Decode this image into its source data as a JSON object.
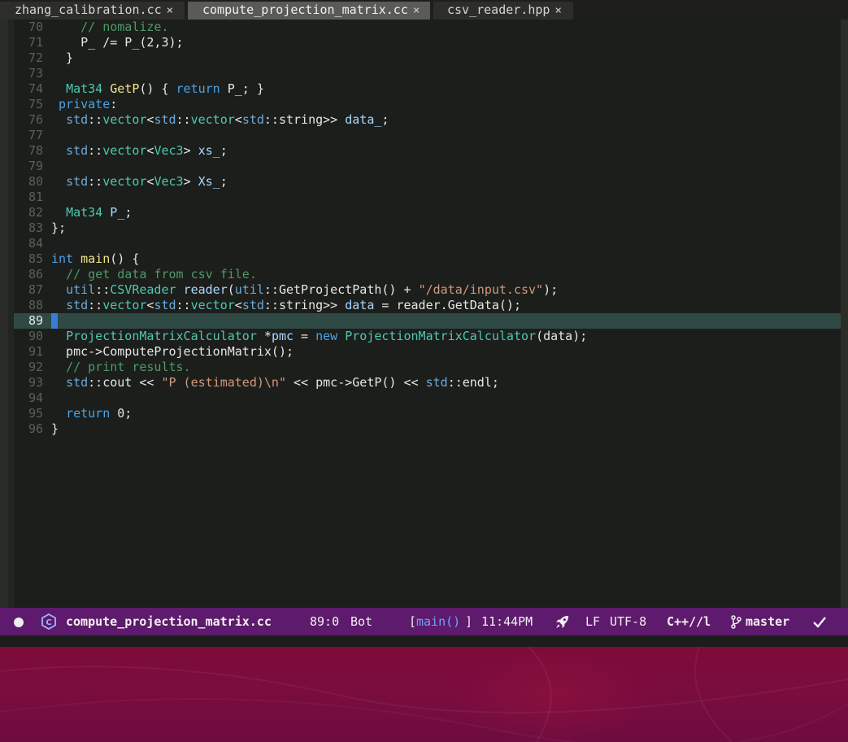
{
  "tabs": [
    {
      "label": "zhang_calibration.cc",
      "close": "×",
      "active": false
    },
    {
      "label": "compute_projection_matrix.cc",
      "close": "×",
      "active": true
    },
    {
      "label": "csv_reader.hpp",
      "close": "×",
      "active": false
    }
  ],
  "editor": {
    "current_line": "89",
    "lines": [
      {
        "n": "70",
        "tokens": [
          [
            "    ",
            "plain"
          ],
          [
            "// nomalize.",
            "com"
          ]
        ]
      },
      {
        "n": "71",
        "tokens": [
          [
            "    P_ /= P_(2,3);",
            "plain"
          ]
        ]
      },
      {
        "n": "72",
        "tokens": [
          [
            "  }",
            "plain"
          ]
        ]
      },
      {
        "n": "73",
        "tokens": []
      },
      {
        "n": "74",
        "tokens": [
          [
            "  ",
            "plain"
          ],
          [
            "Mat34",
            "type"
          ],
          [
            " ",
            "plain"
          ],
          [
            "GetP",
            "fn"
          ],
          [
            "() { ",
            "plain"
          ],
          [
            "return",
            "kw"
          ],
          [
            " P_; }",
            "plain"
          ]
        ]
      },
      {
        "n": "75",
        "tokens": [
          [
            " ",
            "plain"
          ],
          [
            "private",
            "kw"
          ],
          [
            ":",
            "plain"
          ]
        ]
      },
      {
        "n": "76",
        "tokens": [
          [
            "  ",
            "plain"
          ],
          [
            "std",
            "ns"
          ],
          [
            "::",
            "plain"
          ],
          [
            "vector",
            "type"
          ],
          [
            "<",
            "plain"
          ],
          [
            "std",
            "ns"
          ],
          [
            "::",
            "plain"
          ],
          [
            "vector",
            "type"
          ],
          [
            "<",
            "plain"
          ],
          [
            "std",
            "ns"
          ],
          [
            "::",
            "plain"
          ],
          [
            "string>> ",
            "plain"
          ],
          [
            "data_",
            "var"
          ],
          [
            ";",
            "plain"
          ]
        ]
      },
      {
        "n": "77",
        "tokens": []
      },
      {
        "n": "78",
        "tokens": [
          [
            "  ",
            "plain"
          ],
          [
            "std",
            "ns"
          ],
          [
            "::",
            "plain"
          ],
          [
            "vector",
            "type"
          ],
          [
            "<",
            "plain"
          ],
          [
            "Vec3",
            "type"
          ],
          [
            "> ",
            "plain"
          ],
          [
            "xs_",
            "var"
          ],
          [
            ";",
            "plain"
          ]
        ]
      },
      {
        "n": "79",
        "tokens": []
      },
      {
        "n": "80",
        "tokens": [
          [
            "  ",
            "plain"
          ],
          [
            "std",
            "ns"
          ],
          [
            "::",
            "plain"
          ],
          [
            "vector",
            "type"
          ],
          [
            "<",
            "plain"
          ],
          [
            "Vec3",
            "type"
          ],
          [
            "> ",
            "plain"
          ],
          [
            "Xs_",
            "var"
          ],
          [
            ";",
            "plain"
          ]
        ]
      },
      {
        "n": "81",
        "tokens": []
      },
      {
        "n": "82",
        "tokens": [
          [
            "  ",
            "plain"
          ],
          [
            "Mat34",
            "type"
          ],
          [
            " ",
            "plain"
          ],
          [
            "P_",
            "var"
          ],
          [
            ";",
            "plain"
          ]
        ]
      },
      {
        "n": "83",
        "tokens": [
          [
            "};",
            "plain"
          ]
        ]
      },
      {
        "n": "84",
        "tokens": []
      },
      {
        "n": "85",
        "tokens": [
          [
            "int",
            "kw"
          ],
          [
            " ",
            "plain"
          ],
          [
            "main",
            "fn"
          ],
          [
            "() {",
            "plain"
          ]
        ]
      },
      {
        "n": "86",
        "tokens": [
          [
            "  ",
            "plain"
          ],
          [
            "// get data from csv file.",
            "com"
          ]
        ]
      },
      {
        "n": "87",
        "tokens": [
          [
            "  ",
            "plain"
          ],
          [
            "util",
            "ns"
          ],
          [
            "::",
            "plain"
          ],
          [
            "CSVReader",
            "type"
          ],
          [
            " ",
            "plain"
          ],
          [
            "reader",
            "var"
          ],
          [
            "(",
            "plain"
          ],
          [
            "util",
            "ns"
          ],
          [
            "::GetProjectPath() + ",
            "plain"
          ],
          [
            "\"/data/input.csv\"",
            "str"
          ],
          [
            ");",
            "plain"
          ]
        ]
      },
      {
        "n": "88",
        "tokens": [
          [
            "  ",
            "plain"
          ],
          [
            "std",
            "ns"
          ],
          [
            "::",
            "plain"
          ],
          [
            "vector",
            "type"
          ],
          [
            "<",
            "plain"
          ],
          [
            "std",
            "ns"
          ],
          [
            "::",
            "plain"
          ],
          [
            "vector",
            "type"
          ],
          [
            "<",
            "plain"
          ],
          [
            "std",
            "ns"
          ],
          [
            "::",
            "plain"
          ],
          [
            "string>> ",
            "plain"
          ],
          [
            "data",
            "var"
          ],
          [
            " = reader.GetData();",
            "plain"
          ]
        ]
      },
      {
        "n": "89",
        "tokens": []
      },
      {
        "n": "90",
        "tokens": [
          [
            "  ",
            "plain"
          ],
          [
            "ProjectionMatrixCalculator",
            "type"
          ],
          [
            " *",
            "plain"
          ],
          [
            "pmc",
            "var"
          ],
          [
            " = ",
            "plain"
          ],
          [
            "new",
            "kw"
          ],
          [
            " ",
            "plain"
          ],
          [
            "ProjectionMatrixCalculator",
            "type"
          ],
          [
            "(data);",
            "plain"
          ]
        ]
      },
      {
        "n": "91",
        "tokens": [
          [
            "  pmc->ComputeProjectionMatrix();",
            "plain"
          ]
        ]
      },
      {
        "n": "92",
        "tokens": [
          [
            "  ",
            "plain"
          ],
          [
            "// print results.",
            "com"
          ]
        ]
      },
      {
        "n": "93",
        "tokens": [
          [
            "  ",
            "plain"
          ],
          [
            "std",
            "ns"
          ],
          [
            "::cout << ",
            "plain"
          ],
          [
            "\"P (estimated)\\n\"",
            "str"
          ],
          [
            " << pmc->GetP() << ",
            "plain"
          ],
          [
            "std",
            "ns"
          ],
          [
            "::endl;",
            "plain"
          ]
        ]
      },
      {
        "n": "94",
        "tokens": []
      },
      {
        "n": "95",
        "tokens": [
          [
            "  ",
            "plain"
          ],
          [
            "return",
            "kw"
          ],
          [
            " 0;",
            "plain"
          ]
        ]
      },
      {
        "n": "96",
        "tokens": [
          [
            "}",
            "plain"
          ]
        ]
      }
    ]
  },
  "statusbar": {
    "filename": "compute_projection_matrix.cc",
    "position": "89:0",
    "scroll": "Bot",
    "func_open": "[",
    "func_name": "main()",
    "func_close": "]",
    "time": "11:44PM",
    "line_ending": "LF",
    "encoding": "UTF-8",
    "mode": "C++//l",
    "branch": "master",
    "icons": [
      "modified-dot-icon",
      "c-language-icon",
      "rocket-icon",
      "git-branch-icon",
      "checkmark-icon"
    ]
  },
  "colors": {
    "statusbar_bg": "#5e1a6c",
    "current_line_bg": "#2f4a44",
    "cursor": "#3a7bd5",
    "wallpaper": "#7d0c3a"
  }
}
